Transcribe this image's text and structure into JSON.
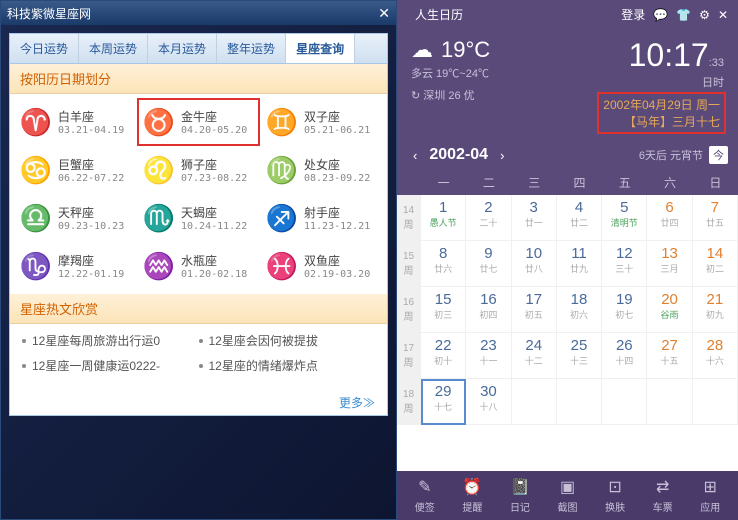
{
  "left": {
    "title": "科技紫微星座网",
    "tabs": [
      "今日运势",
      "本周运势",
      "本月运势",
      "整年运势",
      "星座查询"
    ],
    "activeTab": 4,
    "sectionHeader": "按阳历日期划分",
    "zodiacs": [
      {
        "symbol": "♈",
        "name": "白羊座",
        "date": "03.21-04.19"
      },
      {
        "symbol": "♉",
        "name": "金牛座",
        "date": "04.20-05.20",
        "highlighted": true
      },
      {
        "symbol": "♊",
        "name": "双子座",
        "date": "05.21-06.21"
      },
      {
        "symbol": "♋",
        "name": "巨蟹座",
        "date": "06.22-07.22"
      },
      {
        "symbol": "♌",
        "name": "狮子座",
        "date": "07.23-08.22"
      },
      {
        "symbol": "♍",
        "name": "处女座",
        "date": "08.23-09.22"
      },
      {
        "symbol": "♎",
        "name": "天秤座",
        "date": "09.23-10.23"
      },
      {
        "symbol": "♏",
        "name": "天蝎座",
        "date": "10.24-11.22"
      },
      {
        "symbol": "♐",
        "name": "射手座",
        "date": "11.23-12.21"
      },
      {
        "symbol": "♑",
        "name": "摩羯座",
        "date": "12.22-01.19"
      },
      {
        "symbol": "♒",
        "name": "水瓶座",
        "date": "01.20-02.18"
      },
      {
        "symbol": "♓",
        "name": "双鱼座",
        "date": "02.19-03.20"
      }
    ],
    "hotHeader": "星座热文欣赏",
    "hotItems": [
      "12星座每周旅游出行运0",
      "12星座会因何被提拔",
      "12星座一周健康运0222-",
      "12星座的情绪爆炸点"
    ],
    "more": "更多≫"
  },
  "right": {
    "appTitle": "人生日历",
    "login": "登录",
    "weatherIcon": "☁",
    "temp": "19°C",
    "desc": "多云 19℃~24℃",
    "refresh": "↻",
    "location": "深圳 26 优",
    "time": "10:17",
    "seconds": ":33",
    "timeLabel": "日时",
    "dateLine": "2002年04月29日 周一",
    "lunarLine": "【马年】三月十七",
    "month": "2002-04",
    "festInfo": "6天后 元宵节",
    "todayBtn": "今",
    "weekdays": [
      "一",
      "二",
      "三",
      "四",
      "五",
      "六",
      "日"
    ],
    "weeks": [
      {
        "wk": "14",
        "days": [
          {
            "n": "1",
            "s": "愚人节",
            "fest": true
          },
          {
            "n": "2",
            "s": "二十"
          },
          {
            "n": "3",
            "s": "廿一"
          },
          {
            "n": "4",
            "s": "廿二"
          },
          {
            "n": "5",
            "s": "清明节",
            "fest": true
          },
          {
            "n": "6",
            "s": "廿四",
            "wknd": true
          },
          {
            "n": "7",
            "s": "廿五",
            "wknd": true
          }
        ]
      },
      {
        "wk": "15",
        "days": [
          {
            "n": "8",
            "s": "廿六"
          },
          {
            "n": "9",
            "s": "廿七"
          },
          {
            "n": "10",
            "s": "廿八"
          },
          {
            "n": "11",
            "s": "廿九"
          },
          {
            "n": "12",
            "s": "三十"
          },
          {
            "n": "13",
            "s": "三月",
            "wknd": true
          },
          {
            "n": "14",
            "s": "初二",
            "wknd": true
          }
        ]
      },
      {
        "wk": "16",
        "days": [
          {
            "n": "15",
            "s": "初三"
          },
          {
            "n": "16",
            "s": "初四"
          },
          {
            "n": "17",
            "s": "初五"
          },
          {
            "n": "18",
            "s": "初六"
          },
          {
            "n": "19",
            "s": "初七"
          },
          {
            "n": "20",
            "s": "谷雨",
            "wknd": true,
            "fest": true
          },
          {
            "n": "21",
            "s": "初九",
            "wknd": true
          }
        ]
      },
      {
        "wk": "17",
        "days": [
          {
            "n": "22",
            "s": "初十"
          },
          {
            "n": "23",
            "s": "十一"
          },
          {
            "n": "24",
            "s": "十二"
          },
          {
            "n": "25",
            "s": "十三"
          },
          {
            "n": "26",
            "s": "十四"
          },
          {
            "n": "27",
            "s": "十五",
            "wknd": true
          },
          {
            "n": "28",
            "s": "十六",
            "wknd": true
          }
        ]
      },
      {
        "wk": "18",
        "days": [
          {
            "n": "29",
            "s": "十七",
            "sel": true
          },
          {
            "n": "30",
            "s": "十八"
          },
          {
            "n": "",
            "s": ""
          },
          {
            "n": "",
            "s": ""
          },
          {
            "n": "",
            "s": ""
          },
          {
            "n": "",
            "s": ""
          },
          {
            "n": "",
            "s": ""
          }
        ]
      }
    ],
    "bottom": [
      {
        "icon": "✎",
        "label": "便签"
      },
      {
        "icon": "⏰",
        "label": "提醒"
      },
      {
        "icon": "📓",
        "label": "日记"
      },
      {
        "icon": "▣",
        "label": "截图"
      },
      {
        "icon": "⊡",
        "label": "换肤"
      },
      {
        "icon": "⇄",
        "label": "车票"
      },
      {
        "icon": "⊞",
        "label": "应用"
      }
    ]
  }
}
